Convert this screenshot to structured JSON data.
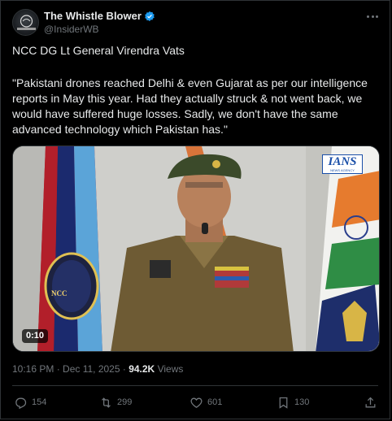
{
  "author": {
    "display_name": "The Whistle Blower",
    "handle": "@InsiderWB",
    "avatar_caption": "WHISTLE BLOWER",
    "verified_color": "#1d9bf0"
  },
  "tweet": {
    "line1": "NCC DG Lt General Virendra Vats",
    "quote": "\"Pakistani drones reached Delhi & even Gujarat as per our intelligence reports in May this year. Had they actually struck & not went back, we would have suffered huge losses. Sadly, we don't have the same advanced technology which Pakistan has.\""
  },
  "media": {
    "duration": "0:10",
    "watermark": "IANS",
    "watermark_sub": "NEWS AGENCY",
    "flag_emblem_text": "NCC"
  },
  "meta": {
    "timestamp": "10:16 PM · Dec 11, 2025",
    "separator": " · ",
    "views_count": "94.2K",
    "views_label": " Views"
  },
  "actions": {
    "replies": "154",
    "reposts": "299",
    "likes": "601",
    "bookmarks": "130"
  },
  "icons": {
    "verified": "verified-badge-icon",
    "more": "more-icon",
    "reply": "reply-icon",
    "repost": "repost-icon",
    "like": "heart-icon",
    "bookmark": "bookmark-icon",
    "share": "share-icon"
  }
}
